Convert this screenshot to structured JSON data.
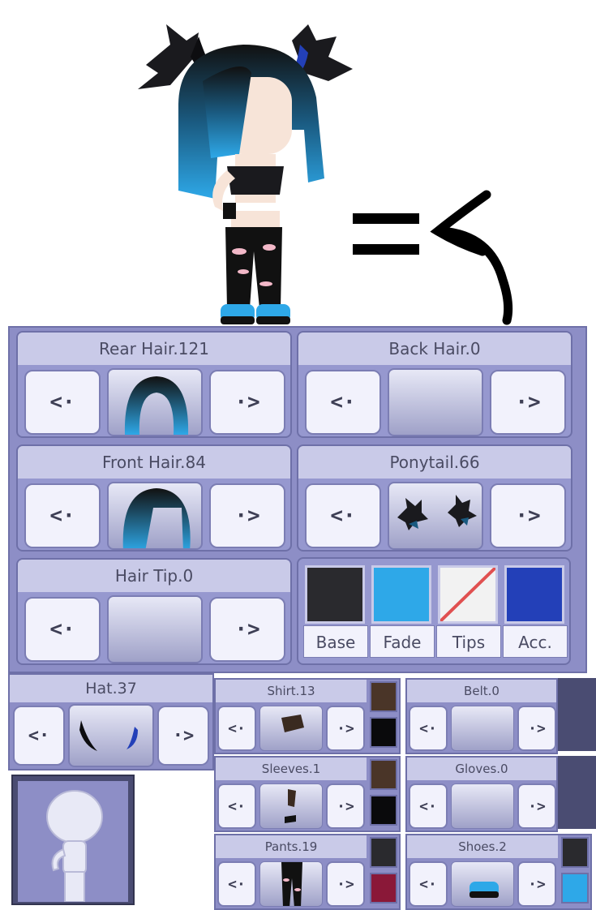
{
  "slots": {
    "rear_hair": {
      "label": "Rear Hair.121"
    },
    "back_hair": {
      "label": "Back Hair.0"
    },
    "front_hair": {
      "label": "Front Hair.84"
    },
    "ponytail": {
      "label": "Ponytail.66"
    },
    "hair_tip": {
      "label": "Hair Tip.0"
    }
  },
  "nav": {
    "prev_glyph": "<·",
    "next_glyph": "·>"
  },
  "colors": {
    "base": {
      "label": "Base",
      "color": "#2a2a2e"
    },
    "fade": {
      "label": "Fade",
      "color": "#2ea8e8"
    },
    "tips": {
      "label": "Tips",
      "color": "#f2f2f2"
    },
    "acc": {
      "label": "Acc.",
      "color": "#2340b8"
    }
  },
  "hat": {
    "label": "Hat.37"
  },
  "clothes": [
    {
      "label": "Shirt.13",
      "swatches": [
        "#4a3528",
        "#0a0a0c"
      ]
    },
    {
      "label": "Belt.0",
      "swatches": []
    },
    {
      "label": "Sleeves.1",
      "swatches": [
        "#4a3528",
        "#0a0a0c"
      ]
    },
    {
      "label": "Gloves.0",
      "swatches": []
    },
    {
      "label": "Pants.19",
      "swatches": [
        "#2a2a2e",
        "#8a1838"
      ]
    },
    {
      "label": "Shoes.2",
      "swatches": [
        "#2a2a2e",
        "#2ea8e8"
      ]
    }
  ]
}
